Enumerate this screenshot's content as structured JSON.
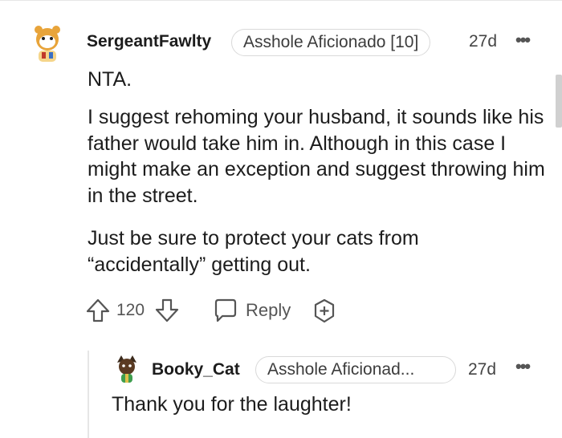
{
  "comment": {
    "username": "SergeantFawlty",
    "flair": "Asshole Aficionado [10]",
    "age": "27d",
    "more_icon": "ellipsis-icon",
    "paragraphs": [
      "NTA.",
      "I suggest rehoming your husband, it sounds like his father would take him in. Although in this case I might make an exception and suggest throwing him in the street.",
      "Just be sure to protect your cats from “accidentally” getting out."
    ],
    "votes": "120",
    "reply_label": "Reply"
  },
  "reply": {
    "username": "Booky_Cat",
    "flair": "Asshole Aficionad...",
    "age": "27d",
    "text": "Thank you for the laughter!"
  },
  "colors": {
    "text": "#1c1c1c",
    "muted": "#555555",
    "border": "#d9d9d9",
    "avatar_orange": "#e8a43a"
  }
}
